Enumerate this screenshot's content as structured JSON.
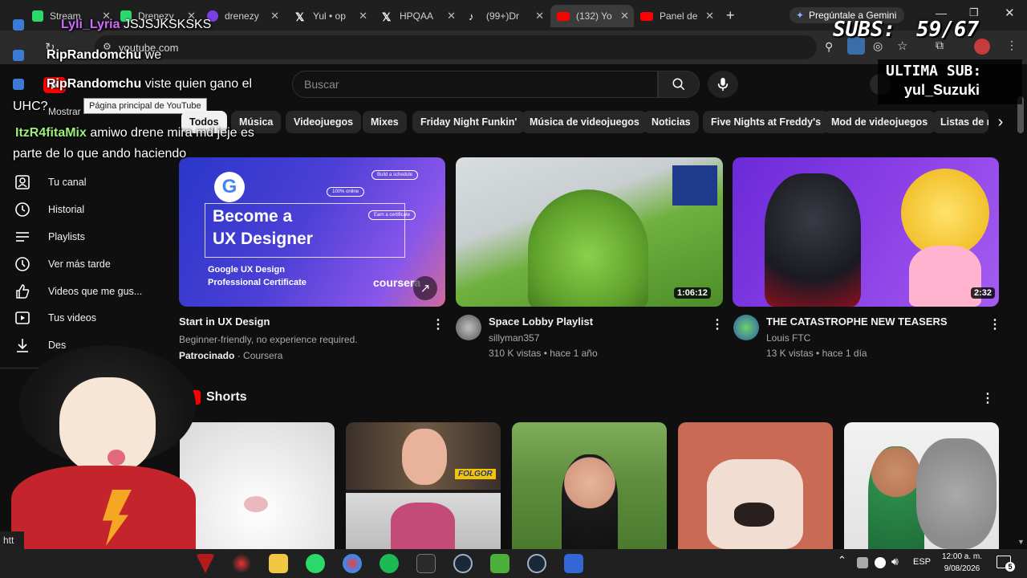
{
  "tabs": [
    {
      "label": "Stream",
      "color": "#2bd96b"
    },
    {
      "label": "Drenezy",
      "color": "#2bd96b"
    },
    {
      "label": "drenezy",
      "color": "#7b3fe4"
    },
    {
      "label": "Yul • op",
      "color": "#e7e7e7"
    },
    {
      "label": "HPQAA",
      "color": "#e7e7e7"
    },
    {
      "label": "(99+)Dr",
      "color": "#e7e7e7"
    },
    {
      "label": "(132) Yo",
      "color": "#ff0000"
    },
    {
      "label": "Panel de",
      "color": "#ff0000"
    }
  ],
  "gemini_button": "Pregúntale a Gemini",
  "address": "youtube.com",
  "youtube": {
    "logo_tooltip": "Página principal de YouTube",
    "search_placeholder": "Buscar",
    "chips": [
      "Todos",
      "Música",
      "Videojuegos",
      "Mixes",
      "Friday Night Funkin'",
      "Música de videojuegos",
      "Noticias",
      "Five Nights at Freddy's",
      "Mod de videojuegos",
      "Listas de r"
    ],
    "sidebar": [
      "Tu canal",
      "Historial",
      "Playlists",
      "Ver más tarde",
      "Videos que me gus...",
      "Tus videos",
      "Des"
    ],
    "sidebar_mostrar": "Mostrar",
    "videos": [
      {
        "title": "Start in UX Design",
        "line1": "Beginner-friendly, no experience required.",
        "sponsored": "Patrocinado",
        "channel": "Coursera",
        "thumb_headline1": "Become a",
        "thumb_headline2": "UX Designer",
        "thumb_sub1": "Google UX Design",
        "thumb_sub2": "Professional Certificate",
        "thumb_brand": "coursera",
        "badge1": "Build a schedule",
        "badge2": "100% online",
        "badge3": "Earn a certificate"
      },
      {
        "title": "Space Lobby Playlist",
        "channel": "sillyman357",
        "stats": "310 K vistas • hace 1 año",
        "duration": "1:06:12"
      },
      {
        "title": "THE CATASTROPHE NEW TEASERS",
        "channel": "Louis FTC",
        "stats": "13 K vistas • hace 1 día",
        "duration": "2:32"
      }
    ],
    "shorts_title": "Shorts",
    "shorts_overlay_text": "FOLGOR"
  },
  "chat": [
    {
      "user": "Lyli_Lyria",
      "msg": "JSJSJKSKSKS",
      "color": "#cf6bff"
    },
    {
      "user": "RipRandomchu",
      "msg": "we",
      "color": "#ffffff"
    },
    {
      "user": "RipRandomchu",
      "msg": "viste quien gano el",
      "color": "#ffffff"
    },
    {
      "user": "",
      "msg": "UHC?",
      "color": "#ffffff"
    },
    {
      "user": "ItzR4fitaMix",
      "msg": "amiwo drene mira md jeje es",
      "color": "#9bf07a"
    },
    {
      "user": "",
      "msg": "parte de lo que ando haciendo",
      "color": "#ffffff"
    }
  ],
  "overlay": {
    "subs_label": "SUBS:",
    "subs_value": "59/67",
    "last_sub_label": "ULTIMA SUB:",
    "last_sub_name": "yul_Suzuki"
  },
  "taskbar": {
    "lang": "ESP",
    "time": "12:00 a. m.",
    "date": "9/08/2026",
    "notif_count": "5",
    "status_text": "htt"
  }
}
